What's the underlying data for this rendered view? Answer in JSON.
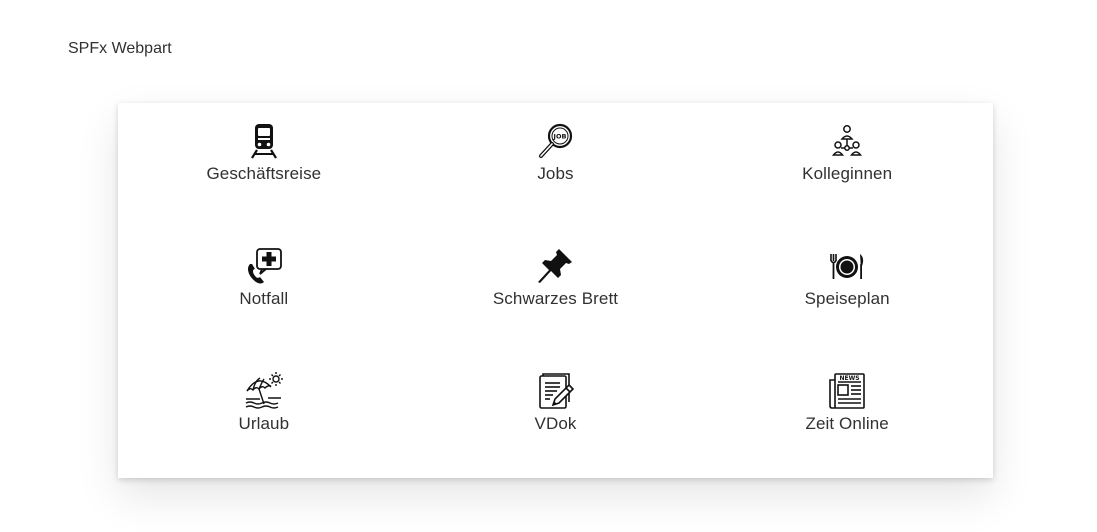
{
  "page": {
    "title": "SPFx Webpart"
  },
  "tiles": [
    {
      "label": "Geschäftsreise",
      "icon": "train-icon"
    },
    {
      "label": "Jobs",
      "icon": "job-search-icon"
    },
    {
      "label": "Kolleginnen",
      "icon": "people-network-icon"
    },
    {
      "label": "Notfall",
      "icon": "emergency-call-icon"
    },
    {
      "label": "Schwarzes Brett",
      "icon": "pushpin-icon"
    },
    {
      "label": "Speiseplan",
      "icon": "plate-cutlery-icon"
    },
    {
      "label": "Urlaub",
      "icon": "beach-umbrella-icon"
    },
    {
      "label": "VDok",
      "icon": "document-edit-icon"
    },
    {
      "label": "Zeit Online",
      "icon": "newspaper-icon"
    }
  ],
  "colors": {
    "text": "#323130",
    "icon": "#111111",
    "card_bg": "#ffffff"
  },
  "icon_texts": {
    "job_badge": "JOB",
    "news_masthead": "NEWS"
  }
}
